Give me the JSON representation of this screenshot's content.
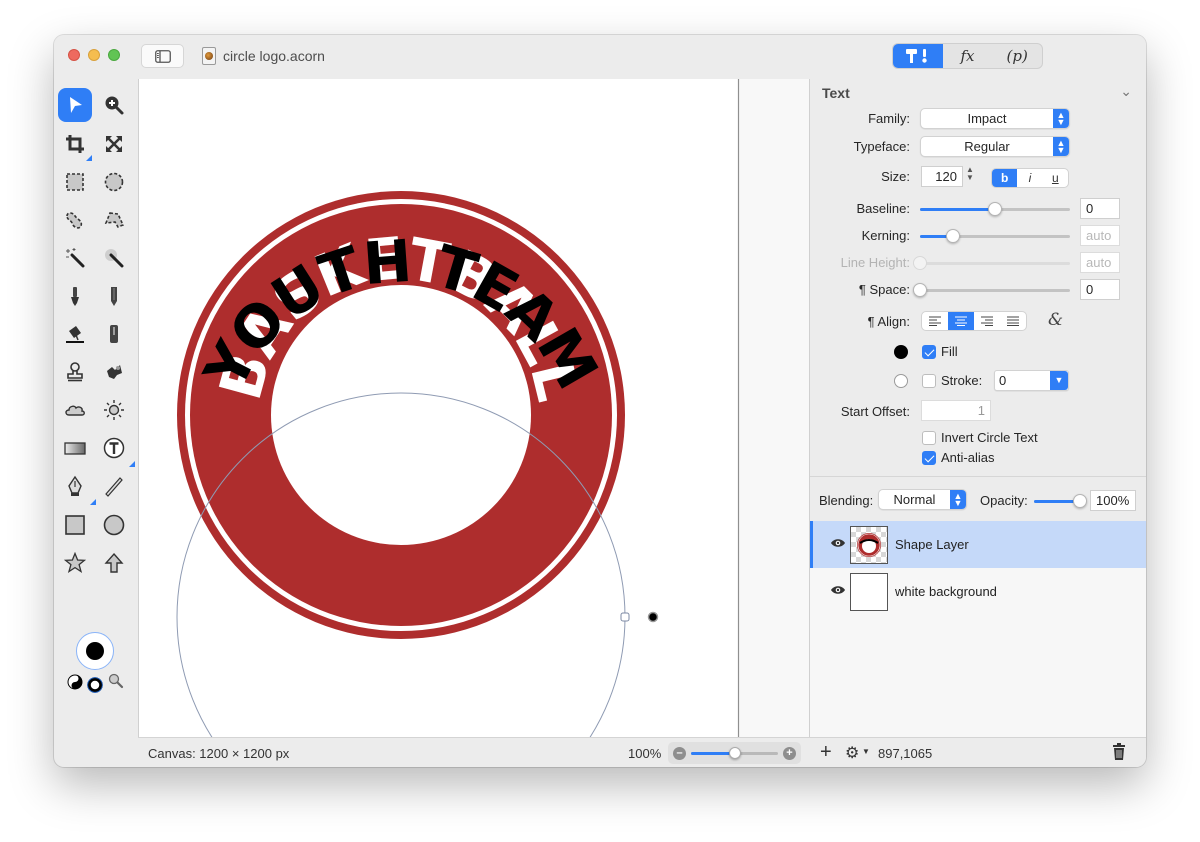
{
  "window": {
    "title": "circle logo.acorn",
    "top_tabs": [
      {
        "name": "tools-tab",
        "label": "T!",
        "active": true
      },
      {
        "name": "effects-tab",
        "label": "fx",
        "active": false
      },
      {
        "name": "properties-tab",
        "label": "(p)",
        "active": false
      }
    ]
  },
  "tools": [
    {
      "name": "select-tool",
      "icon": "arrow-pointer-icon",
      "active": true
    },
    {
      "name": "zoom-tool",
      "icon": "zoom-in-icon"
    },
    {
      "name": "crop-tool",
      "icon": "crop-icon",
      "submenu": true
    },
    {
      "name": "transform-tool",
      "icon": "expand-arrows-icon"
    },
    {
      "name": "rect-select-tool",
      "icon": "rect-marquee-icon"
    },
    {
      "name": "ellipse-select-tool",
      "icon": "ellipse-marquee-icon"
    },
    {
      "name": "lasso-tool",
      "icon": "lasso-icon"
    },
    {
      "name": "polygon-lasso-tool",
      "icon": "polygon-lasso-icon"
    },
    {
      "name": "magic-wand-tool",
      "icon": "magic-wand-icon"
    },
    {
      "name": "instant-alpha-tool",
      "icon": "instant-alpha-icon"
    },
    {
      "name": "brush-tool",
      "icon": "brush-icon"
    },
    {
      "name": "pencil-tool",
      "icon": "pencil-icon"
    },
    {
      "name": "paint-bucket-tool",
      "icon": "paint-bucket-icon"
    },
    {
      "name": "eraser-tool",
      "icon": "eraser-icon"
    },
    {
      "name": "clone-tool",
      "icon": "stamp-icon"
    },
    {
      "name": "smudge-tool",
      "icon": "smudge-icon"
    },
    {
      "name": "burn-tool",
      "icon": "cloud-icon"
    },
    {
      "name": "dodge-tool",
      "icon": "sun-icon"
    },
    {
      "name": "gradient-tool",
      "icon": "gradient-icon"
    },
    {
      "name": "text-tool",
      "icon": "text-circle-icon",
      "submenu": true
    },
    {
      "name": "bezier-pen-tool",
      "icon": "pen-nib-icon",
      "submenu": true
    },
    {
      "name": "line-tool",
      "icon": "line-icon"
    },
    {
      "name": "rectangle-tool",
      "icon": "square-icon"
    },
    {
      "name": "oval-tool",
      "icon": "circle-icon"
    },
    {
      "name": "star-tool",
      "icon": "star-icon"
    },
    {
      "name": "arrow-tool",
      "icon": "arrow-up-icon"
    }
  ],
  "colors": {
    "foreground": "#000000",
    "accent": "#2f7ef6",
    "logo_red": "#ae2d2d",
    "selected_row": "#c5d9f9"
  },
  "canvas": {
    "logo_top_text": "BASKETBALL",
    "logo_bottom_text": "YOUTH TEAM"
  },
  "status": {
    "canvas_size": "Canvas: 1200 × 1200 px",
    "zoom": "100%",
    "zoom_fraction": 0.5,
    "coords": "897,1065"
  },
  "inspector": {
    "section_title": "Text",
    "family_label": "Family:",
    "family_value": "Impact",
    "typeface_label": "Typeface:",
    "typeface_value": "Regular",
    "size_label": "Size:",
    "size_value": "120",
    "style_buttons": [
      {
        "label": "b",
        "active": true
      },
      {
        "label": "i",
        "active": false
      },
      {
        "label": "u",
        "active": false
      }
    ],
    "baseline_label": "Baseline:",
    "baseline_value": "0",
    "baseline_fraction": 0.5,
    "kerning_label": "Kerning:",
    "kerning_value": "auto",
    "kerning_fraction": 0.22,
    "line_height_label": "Line Height:",
    "line_height_value": "auto",
    "line_height_fraction": 0.0,
    "space_label": "¶ Space:",
    "space_value": "0",
    "space_fraction": 0.0,
    "align_label": "¶ Align:",
    "align_options": [
      "left",
      "center",
      "right",
      "justify"
    ],
    "align_selected": "center",
    "ligature_icon": "&",
    "fill_label": "Fill",
    "fill_checked": true,
    "fill_color": "#000000",
    "stroke_label": "Stroke:",
    "stroke_checked": false,
    "stroke_value": "0",
    "stroke_color": "#ffffff",
    "start_offset_label": "Start Offset:",
    "start_offset_value": "1",
    "invert_label": "Invert Circle Text",
    "invert_checked": false,
    "antialias_label": "Anti-alias",
    "antialias_checked": true
  },
  "layers_panel": {
    "blending_label": "Blending:",
    "blending_value": "Normal",
    "opacity_label": "Opacity:",
    "opacity_value": "100%",
    "opacity_fraction": 1.0,
    "layers": [
      {
        "name": "Shape Layer",
        "visible": true,
        "selected": true
      },
      {
        "name": "white background",
        "visible": true,
        "selected": false
      }
    ]
  }
}
